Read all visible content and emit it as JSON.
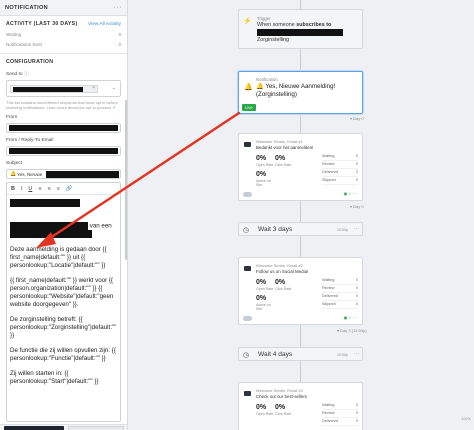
{
  "sidebar": {
    "header_title": "NOTIFICATION",
    "activity_title": "ACTIVITY (LAST 30 DAYS)",
    "view_all": "View All Activity",
    "waiting_label": "Waiting",
    "waiting_value": "0",
    "sent_label": "Notifications Sent",
    "sent_value": "0",
    "config_title": "CONFIGURATION",
    "send_to_label": "Send to",
    "send_to_hint": "This list contains unconfirmed recipients that must opt in before receiving notifications. Learn more about the opt-in process",
    "from_label": "From",
    "reply_label": "From / Reply-To Email",
    "subject_label": "Subject",
    "subject_value": "Yes, Nieuwe",
    "toolbar": [
      "B",
      "I",
      "U",
      "≡",
      "≡",
      "≡",
      "🔗"
    ],
    "body_lines": [
      "van een",
      "Deze aanmelding is gedaan door {{ first_name|default:\"\" }} uit {{ personlookup:\"Locatie\"|default:\"\" }}",
      "{{ first_name|default:\"\" }} werkt voor {{ person.organization|default:\"\" }} {{ personlookup:\"Website\"|default:\"geen website doorgegeven\" }}.",
      "De zorginstelling betreft: {{ personlookup:\"Zorginstelling\"|default:\"\" }}",
      "De functie die zij willen opvullen zijn: {{ personlookup:\"Functie\"|default:\"\" }}",
      "Zij willen starten in: {{ personlookup:\"Start\"|default:\"\" }}"
    ]
  },
  "flow": {
    "trigger_caption": "Trigger",
    "trigger_pre": "When someone",
    "trigger_bold": "subscribes to",
    "trigger_tail": "Zorginstelling",
    "notif_caption": "Notification",
    "notif_title": "Yes, Nieuwe Aanmelding! (Zorginstelling)",
    "live_badge": "Live",
    "day_delay": "Day 0",
    "emails": [
      {
        "caption": "Welcome Series, Email #1",
        "subject": "Bedankt voor het aanmelden!",
        "open_rate": "0%",
        "open_label": "Open Rate",
        "click_rate": "0%",
        "click_label": "Click Rate",
        "active": "0%",
        "active_label": "Active on Site",
        "side": [
          [
            "Waiting",
            "0"
          ],
          [
            "Review",
            "0"
          ],
          [
            "Delivered",
            "2"
          ],
          [
            "Skipped",
            "0"
          ]
        ],
        "delay": "Day 0"
      },
      {
        "caption": "Welcome Series, Email #2",
        "subject": "Follow us on Social Media!",
        "open_rate": "0%",
        "open_label": "Open Rate",
        "click_rate": "0%",
        "click_label": "Click Rate",
        "active": "0%",
        "active_label": "Active on Site",
        "side": [
          [
            "Waiting",
            "0"
          ],
          [
            "Review",
            "0"
          ],
          [
            "Delivered",
            "0"
          ],
          [
            "Skipped",
            "0"
          ]
        ],
        "delay": "Day 3 (12:00p)"
      },
      {
        "caption": "Welcome Series, Email #3",
        "subject": "Check out our best-sellers",
        "open_rate": "0%",
        "open_label": "Open Rate",
        "click_rate": "0%",
        "click_label": "Click Rate",
        "active": "0%",
        "active_label": "Active on Site",
        "side": [
          [
            "Waiting",
            "0"
          ],
          [
            "Review",
            "0"
          ],
          [
            "Delivered",
            "0"
          ],
          [
            "Skipped",
            "0"
          ]
        ],
        "delay": ""
      }
    ],
    "waits": [
      {
        "label": "Wait 3 days",
        "time": "12:00p"
      },
      {
        "label": "Wait 4 days",
        "time": "12:00p"
      }
    ],
    "zoom": "100%"
  },
  "colors": {
    "live": "#27a745",
    "arrow": "#e53323",
    "link": "#2e8bd8"
  }
}
